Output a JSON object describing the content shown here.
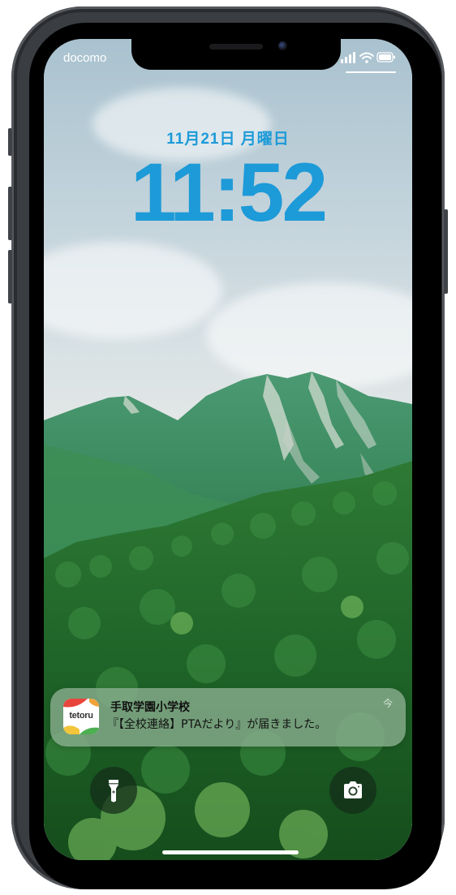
{
  "status_bar": {
    "carrier": "docomo",
    "signal_icon": "signal-bars-icon",
    "wifi_icon": "wifi-icon",
    "battery_icon": "battery-icon"
  },
  "lock_screen": {
    "date": "11月21日 月曜日",
    "time": "11:52",
    "accent_color": "#1d9ad8"
  },
  "notification": {
    "app_icon_text": "tetoru",
    "title": "手取学園小学校",
    "body": "『【全校連絡】PTAだより』が届きました。",
    "time": "今"
  },
  "quick_actions": {
    "left_icon": "flashlight-icon",
    "right_icon": "camera-icon"
  }
}
